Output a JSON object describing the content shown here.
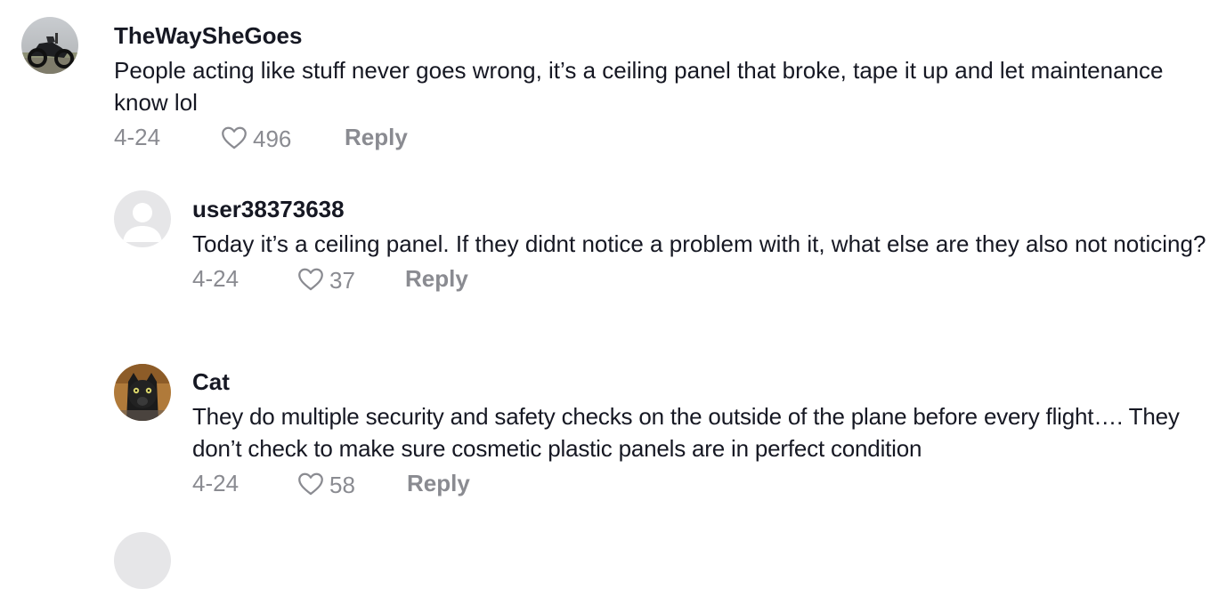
{
  "comments": [
    {
      "username": "TheWaySheGoes",
      "text": "People acting like stuff never goes wrong, it’s a ceiling panel that broke, tape it up and let maintenance know lol",
      "date": "4-24",
      "likes": "496",
      "reply_label": "Reply",
      "avatar_icon": "motorcycle-photo"
    },
    {
      "username": "user38373638",
      "text": "Today it’s a ceiling panel. If they didnt notice a problem with it, what else are they also not noticing?",
      "date": "4-24",
      "likes": "37",
      "reply_label": "Reply",
      "avatar_icon": "default-user-icon"
    },
    {
      "username": "Cat",
      "text": "They do multiple security and safety checks on the outside of the plane before every flight…. They don’t check to make sure cosmetic plastic panels are in perfect condition",
      "date": "4-24",
      "likes": "58",
      "reply_label": "Reply",
      "avatar_icon": "black-cat-photo"
    }
  ],
  "colors": {
    "text": "#161823",
    "meta": "#8a8b91",
    "avatar_default_bg": "#e6e6e8"
  }
}
